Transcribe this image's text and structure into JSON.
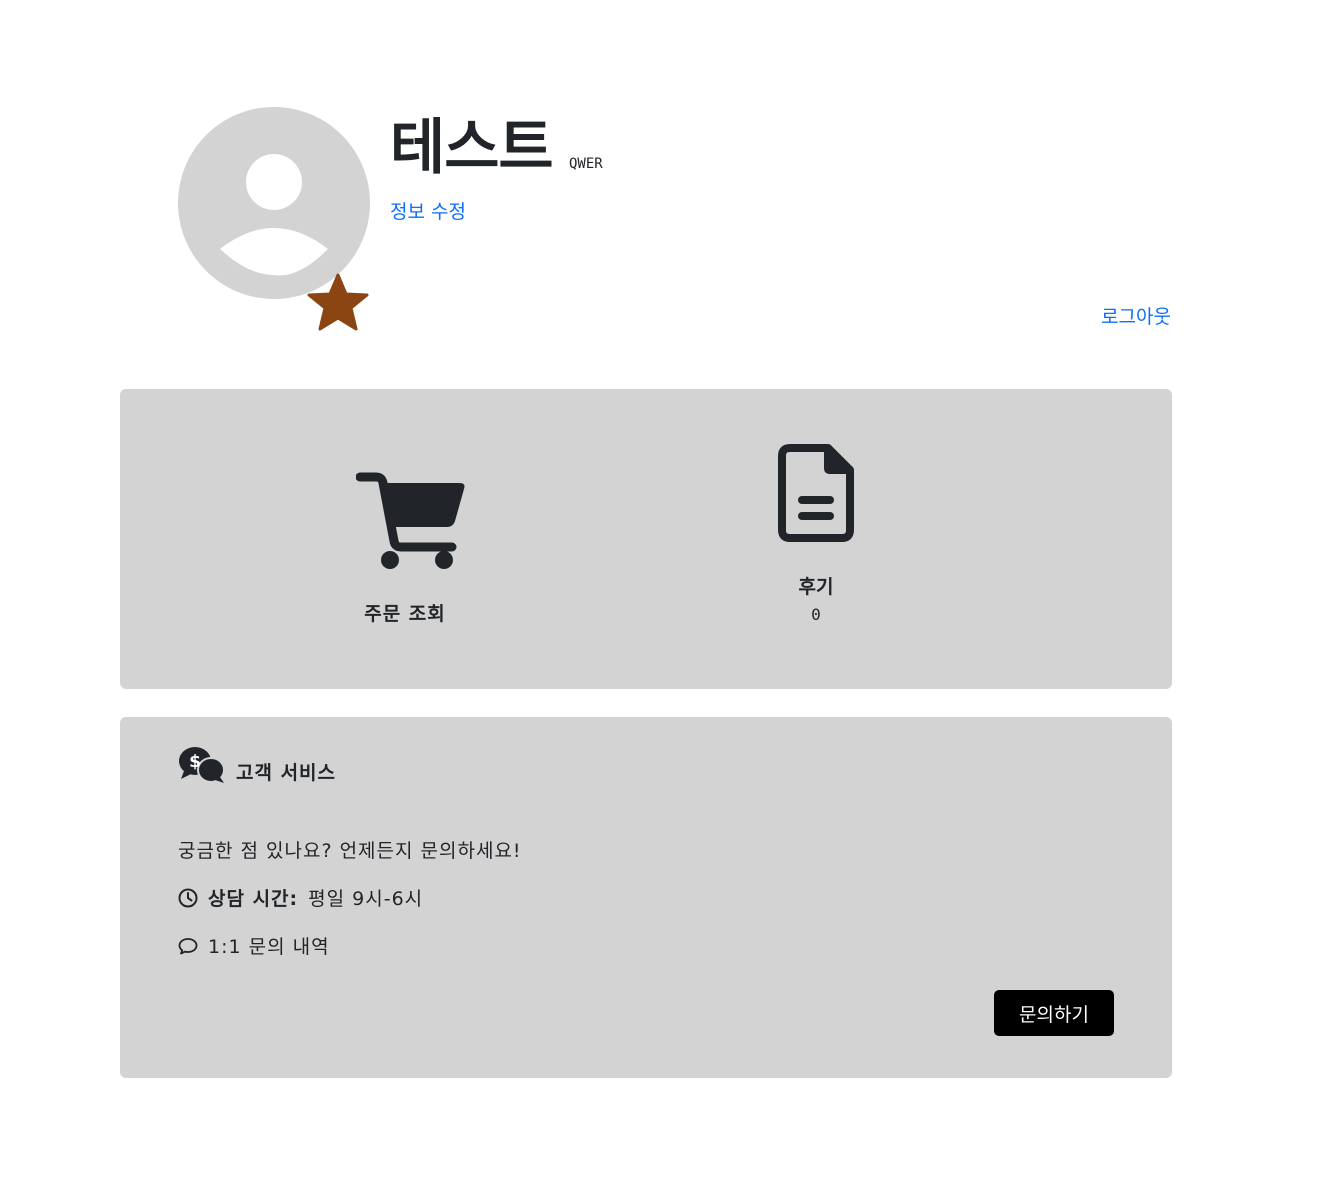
{
  "profile": {
    "name": "테스트",
    "user_id": "QWER",
    "edit_label": "정보 수정",
    "logout_label": "로그아웃",
    "avatar_icon": "user-icon",
    "rank_icon": "star-icon",
    "rank_color": "#8B4513"
  },
  "summary": {
    "orders": {
      "icon": "cart-icon",
      "label": "주문 조회"
    },
    "reviews": {
      "icon": "file-lines-icon",
      "label": "후기",
      "count": "0"
    }
  },
  "customer_service": {
    "icon": "comments-dollar-icon",
    "title": "고객 서비스",
    "message": "궁금한 점 있나요? 언제든지 문의하세요!",
    "hours_label": "상담 시간:",
    "hours_value": "평일 9시-6시",
    "history_label": "1:1 문의 내역",
    "inquiry_button": "문의하기"
  },
  "colors": {
    "link": "#0d6efd",
    "panel_bg": "#d3d3d3",
    "button_bg": "#000000"
  }
}
